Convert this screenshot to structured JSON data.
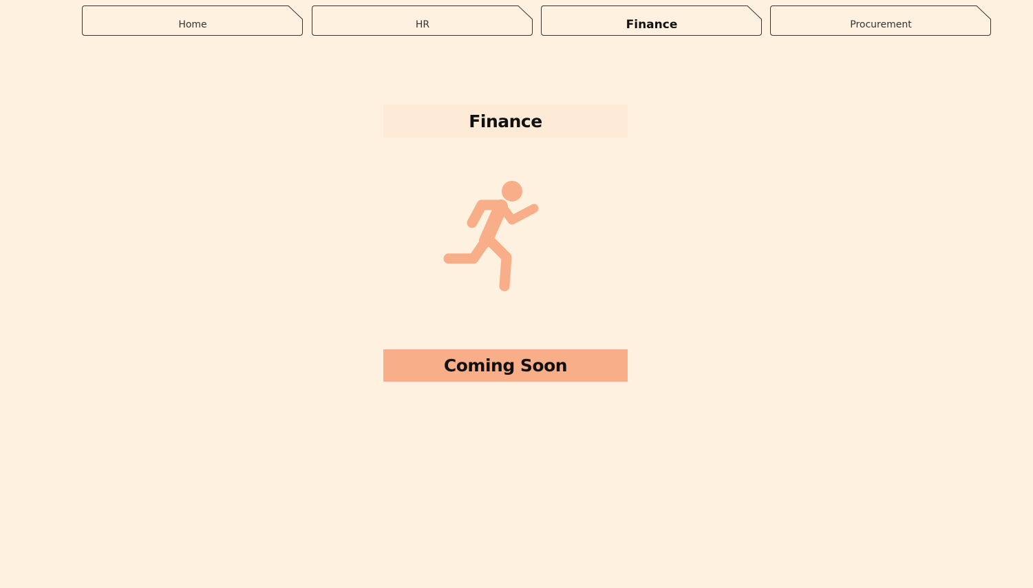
{
  "nav": {
    "tabs": [
      {
        "label": "Home",
        "active": false
      },
      {
        "label": "HR",
        "active": false
      },
      {
        "label": "Finance",
        "active": true
      },
      {
        "label": "Procurement",
        "active": false
      }
    ]
  },
  "main": {
    "title": "Finance",
    "icon": "running-person-icon",
    "status": "Coming Soon"
  },
  "colors": {
    "background": "#FEF1E0",
    "title_background": "#FDEBD8",
    "accent": "#F8AE88",
    "tab_border": "#333333"
  }
}
